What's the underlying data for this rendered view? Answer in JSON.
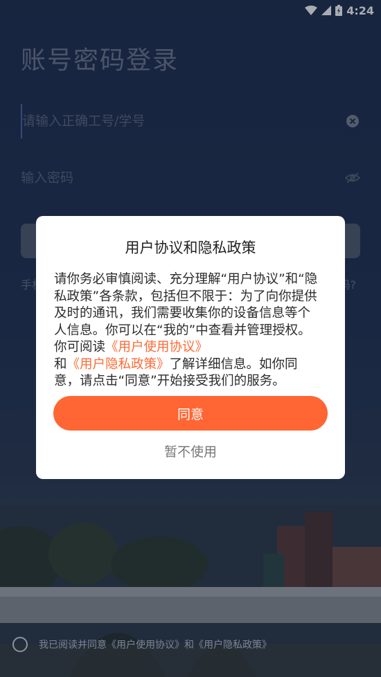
{
  "status_bar": {
    "time": "4:24"
  },
  "login": {
    "title": "账号密码登录",
    "account_placeholder": "请输入正确工号/学号",
    "password_placeholder": "输入密码",
    "left_hint": "手机",
    "right_hint": "码?"
  },
  "dialog": {
    "title": "用户协议和隐私政策",
    "body": {
      "part1": "请你务必审慎阅读、充分理解“用户协议”和“隐私政策”各条款，包括但不限于：为了向你提供及时的通讯，我们需要收集你的设备信息等个人信息。你可以在“我的”中查看并管理授权。你可阅读",
      "link1": "《用户使用协议》",
      "part2": "和",
      "link2": "《用户隐私政策》",
      "part3": "了解详细信息。如你同意，请点击“同意”开始接受我们的服务。"
    },
    "agree_label": "同意",
    "decline_label": "暂不使用"
  },
  "consent": {
    "text": "我已阅读并同意《用户使用协议》和《用户隐私政策》"
  },
  "colors": {
    "accent": "#ff6633",
    "link": "#ff6a35"
  }
}
